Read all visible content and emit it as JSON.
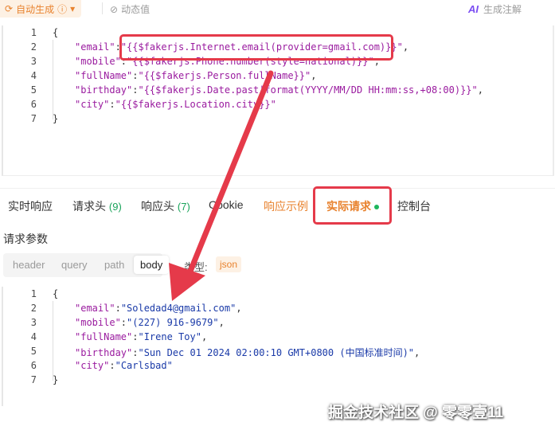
{
  "toolbar": {
    "auto_generate_label": "自动生成",
    "dynamic_value_label": "动态值",
    "ai_badge": "AI",
    "ai_generate_comment_label": "生成注解"
  },
  "template_editor": {
    "line_numbers": [
      "1",
      "2",
      "3",
      "4",
      "5",
      "6",
      "7"
    ],
    "open_brace": "{",
    "close_brace": "}",
    "fields": [
      {
        "key": "\"email\"",
        "value": "\"{{$fakerjs.Internet.email(provider=gmail.com)}}\""
      },
      {
        "key": "\"mobile\"",
        "value": "\"{{$fakerjs.Phone.number(style=national)}}\""
      },
      {
        "key": "\"fullName\"",
        "value": "\"{{$fakerjs.Person.fullName}}\""
      },
      {
        "key": "\"birthday\"",
        "value": "\"{{$fakerjs.Date.past|format(YYYY/MM/DD HH:mm:ss,+08:00)}}\""
      },
      {
        "key": "\"city\"",
        "value": "\"{{$fakerjs.Location.city}}\""
      }
    ]
  },
  "response_tabs": [
    {
      "label": "实时响应",
      "count": ""
    },
    {
      "label": "请求头",
      "count": "(9)"
    },
    {
      "label": "响应头",
      "count": "(7)"
    },
    {
      "label": "Cookie",
      "count": ""
    },
    {
      "label": "响应示例",
      "count": ""
    },
    {
      "label": "实际请求",
      "count": ""
    },
    {
      "label": "控制台",
      "count": ""
    }
  ],
  "request_params": {
    "title": "请求参数",
    "subtabs": [
      "header",
      "query",
      "path",
      "body"
    ],
    "type_label": "类型:",
    "type_value": "json"
  },
  "actual_request": {
    "line_numbers": [
      "1",
      "2",
      "3",
      "4",
      "5",
      "6",
      "7"
    ],
    "open_brace": "{",
    "close_brace": "}",
    "fields": [
      {
        "key": "\"email\"",
        "value": "\"Soledad4@gmail.com\""
      },
      {
        "key": "\"mobile\"",
        "value": "\"(227) 916-9679\""
      },
      {
        "key": "\"fullName\"",
        "value": "\"Irene Toy\""
      },
      {
        "key": "\"birthday\"",
        "value": "\"Sun Dec 01 2024 02:00:10 GMT+0800 (中国标准时间)\""
      },
      {
        "key": "\"city\"",
        "value": "\"Carlsbad\""
      }
    ]
  },
  "watermark": "掘金技术社区 @ 零零壹11",
  "colors": {
    "accent": "#e8822e",
    "annotation_red": "#e53a4a",
    "count_green": "#19a35a"
  }
}
